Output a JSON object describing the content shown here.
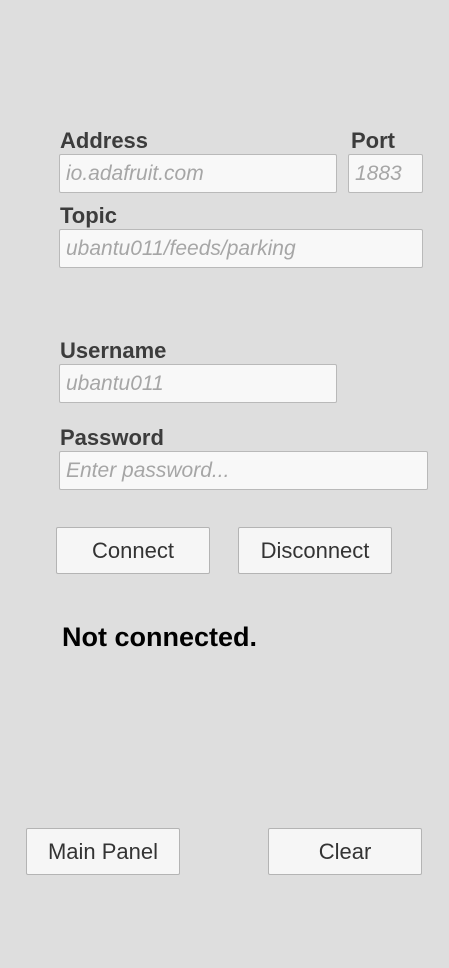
{
  "connection": {
    "address_label": "Address",
    "address_placeholder": "io.adafruit.com",
    "port_label": "Port",
    "port_placeholder": "1883",
    "topic_label": "Topic",
    "topic_placeholder": "ubantu011/feeds/parking"
  },
  "credentials": {
    "username_label": "Username",
    "username_placeholder": "ubantu011",
    "password_label": "Password",
    "password_placeholder": "Enter password..."
  },
  "actions": {
    "connect_label": "Connect",
    "disconnect_label": "Disconnect"
  },
  "status": {
    "text": "Not connected."
  },
  "footer": {
    "main_panel_label": "Main Panel",
    "clear_label": "Clear"
  },
  "colors": {
    "background": "#dedede",
    "field_background": "#f8f8f8",
    "button_background": "#f6f6f6",
    "label_text": "#3c3c3c",
    "placeholder_text": "#a6a6a6"
  }
}
